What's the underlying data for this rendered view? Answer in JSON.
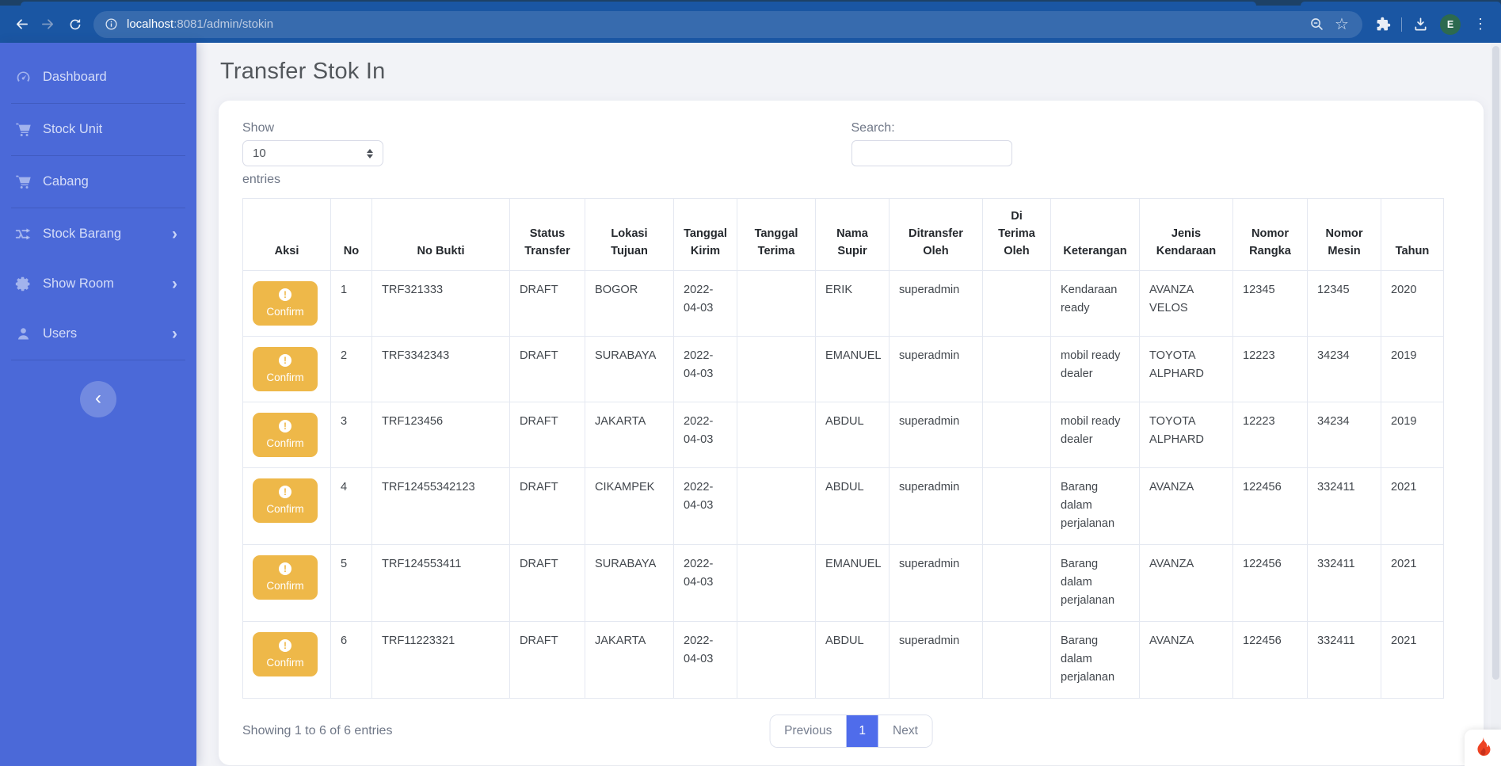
{
  "browser": {
    "url": {
      "host": "localhost",
      "rest": ":8081/admin/stokin"
    },
    "avatar_letter": "E"
  },
  "sidebar": {
    "items": [
      {
        "label": "Dashboard",
        "icon": "dashboard-icon",
        "expandable": false,
        "divider": true
      },
      {
        "label": "Stock Unit",
        "icon": "cart-icon",
        "expandable": false,
        "divider": true
      },
      {
        "label": "Cabang",
        "icon": "cart-icon",
        "expandable": false,
        "divider": true
      },
      {
        "label": "Stock Barang",
        "icon": "shuffle-icon",
        "expandable": true,
        "divider": false
      },
      {
        "label": "Show Room",
        "icon": "gear-icon",
        "expandable": true,
        "divider": false
      },
      {
        "label": "Users",
        "icon": "user-icon",
        "expandable": true,
        "divider": true
      }
    ]
  },
  "page": {
    "title": "Transfer Stok In"
  },
  "table_controls": {
    "show_label": "Show",
    "page_length": "10",
    "entries_label": "entries",
    "search_label": "Search:",
    "search_value": ""
  },
  "table": {
    "confirm_label": "Confirm",
    "headers": [
      "Aksi",
      "No",
      "No Bukti",
      "Status Transfer",
      "Lokasi Tujuan",
      "Tanggal Kirim",
      "Tanggal Terima",
      "Nama Supir",
      "Ditransfer Oleh",
      "Di Terima Oleh",
      "Keterangan",
      "Jenis Kendaraan",
      "Nomor Rangka",
      "Nomor Mesin",
      "Tahun"
    ],
    "rows": [
      [
        "1",
        "TRF321333",
        "DRAFT",
        "BOGOR",
        "2022-04-03",
        "",
        "ERIK",
        "superadmin",
        "",
        "Kendaraan ready",
        "AVANZA VELOS",
        "12345",
        "12345",
        "2020"
      ],
      [
        "2",
        "TRF3342343",
        "DRAFT",
        "SURABAYA",
        "2022-04-03",
        "",
        "EMANUEL",
        "superadmin",
        "",
        "mobil ready dealer",
        "TOYOTA ALPHARD",
        "12223",
        "34234",
        "2019"
      ],
      [
        "3",
        "TRF123456",
        "DRAFT",
        "JAKARTA",
        "2022-04-03",
        "",
        "ABDUL",
        "superadmin",
        "",
        "mobil ready dealer",
        "TOYOTA ALPHARD",
        "12223",
        "34234",
        "2019"
      ],
      [
        "4",
        "TRF12455342123",
        "DRAFT",
        "CIKAMPEK",
        "2022-04-03",
        "",
        "ABDUL",
        "superadmin",
        "",
        "Barang dalam perjalanan",
        "AVANZA",
        "122456",
        "332411",
        "2021"
      ],
      [
        "5",
        "TRF124553411",
        "DRAFT",
        "SURABAYA",
        "2022-04-03",
        "",
        "EMANUEL",
        "superadmin",
        "",
        "Barang dalam perjalanan",
        "AVANZA",
        "122456",
        "332411",
        "2021"
      ],
      [
        "6",
        "TRF11223321",
        "DRAFT",
        "JAKARTA",
        "2022-04-03",
        "",
        "ABDUL",
        "superadmin",
        "",
        "Barang dalam perjalanan",
        "AVANZA",
        "122456",
        "332411",
        "2021"
      ]
    ]
  },
  "footer": {
    "info": "Showing 1 to 6 of 6 entries",
    "prev_label": "Previous",
    "current_page": "1",
    "next_label": "Next"
  },
  "colors": {
    "toolbar": "#1a56a3",
    "sidebar": "#4b69d8",
    "accent": "#4f6ceb",
    "confirm": "#eeb849",
    "flame": "#ee4323",
    "avatar": "#2d6a4f"
  }
}
